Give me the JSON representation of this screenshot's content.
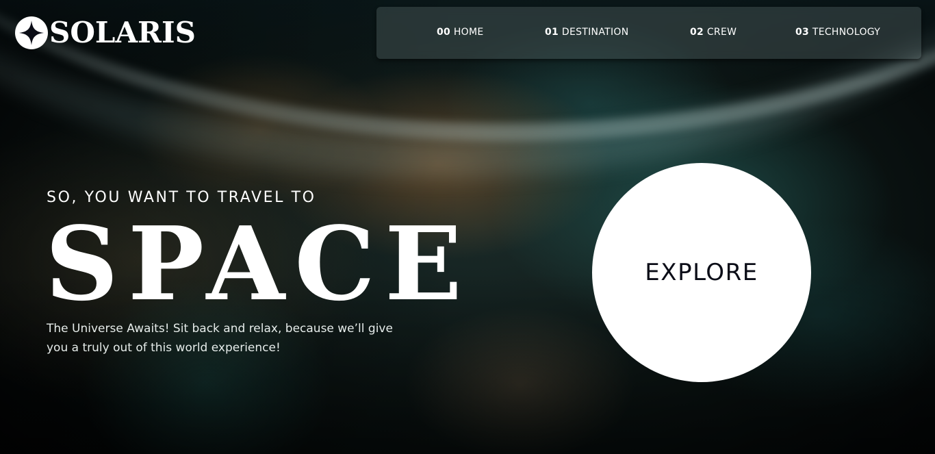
{
  "logo": {
    "text": "SOLARIS",
    "icon": "four-point-star-icon"
  },
  "nav": {
    "items": [
      {
        "number": "00",
        "label": "HOME"
      },
      {
        "number": "01",
        "label": "DESTINATION"
      },
      {
        "number": "02",
        "label": "CREW"
      },
      {
        "number": "03",
        "label": "TECHNOLOGY"
      }
    ]
  },
  "hero": {
    "eyebrow": "SO, YOU WANT TO TRAVEL TO",
    "title": "SPACE",
    "body": "The Universe Awaits! Sit back and relax, because we’ll give you a truly out of this world experience!"
  },
  "explore": {
    "label": "EXPLORE"
  },
  "colors": {
    "text": "#ffffff",
    "button_bg": "#ffffff",
    "button_text": "#0b0d17",
    "nav_bg": "rgba(120,135,135,0.28)"
  }
}
